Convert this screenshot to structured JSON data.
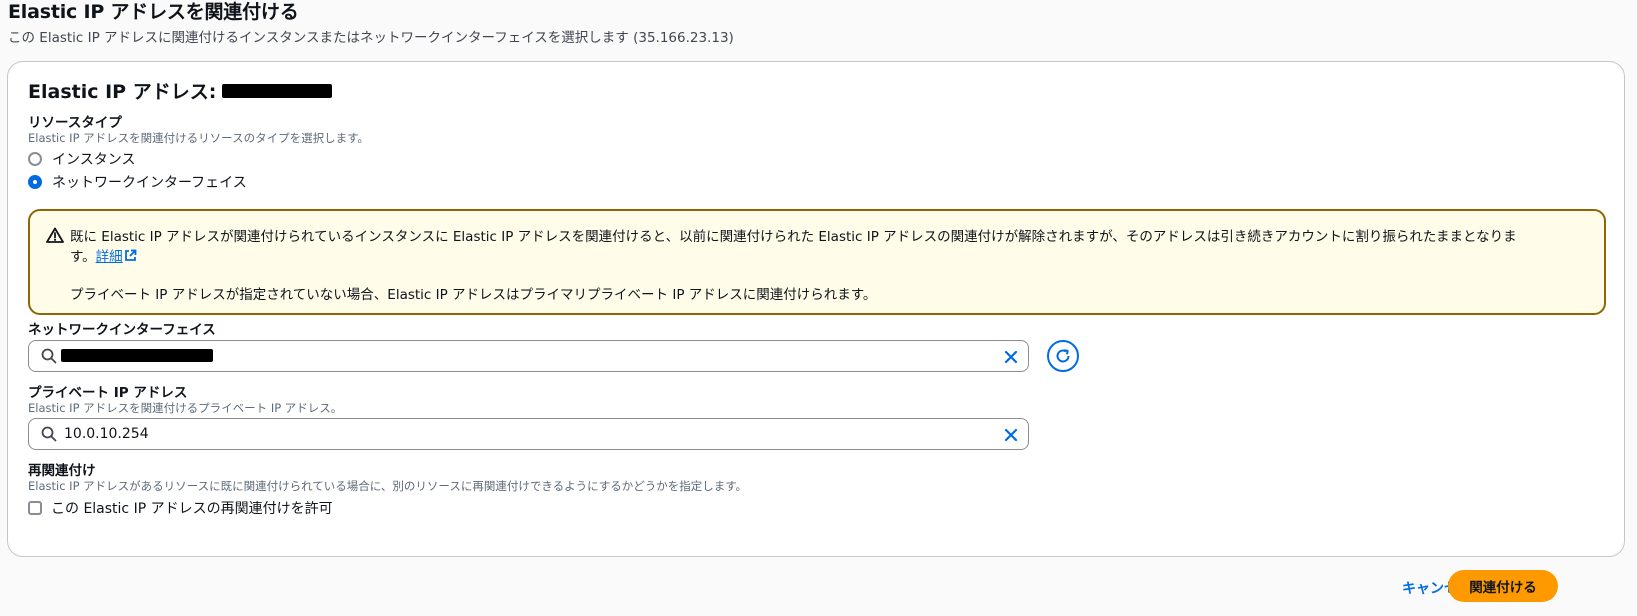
{
  "page": {
    "title": "Elastic IP アドレスを関連付ける",
    "subtitle": "この Elastic IP アドレスに関連付けるインスタンスまたはネットワークインターフェイスを選択します (35.166.23.13)"
  },
  "panel": {
    "heading": "Elastic IP アドレス:"
  },
  "resource_type": {
    "label": "リソースタイプ",
    "description": "Elastic IP アドレスを関連付けるリソースのタイプを選択します。",
    "options": [
      {
        "label": "インスタンス",
        "selected": false
      },
      {
        "label": "ネットワークインターフェイス",
        "selected": true
      }
    ]
  },
  "alert": {
    "line1": "既に Elastic IP アドレスが関連付けられているインスタンスに Elastic IP アドレスを関連付けると、以前に関連付けられた Elastic IP アドレスの関連付けが解除されますが、そのアドレスは引き続きアカウントに割り振られたままとなりま",
    "line2": "す。",
    "link": "詳細",
    "line3": "プライベート IP アドレスが指定されていない場合、Elastic IP アドレスはプライマリプライベート IP アドレスに関連付けられます。"
  },
  "network_interface": {
    "label": "ネットワークインターフェイス"
  },
  "private_ip": {
    "label": "プライベート IP アドレス",
    "description": "Elastic IP アドレスを関連付けるプライベート IP アドレス。",
    "value": "10.0.10.254"
  },
  "reassociation": {
    "label": "再関連付け",
    "description": "Elastic IP アドレスがあるリソースに既に関連付けられている場合に、別のリソースに再関連付けできるようにするかどうかを指定します。",
    "checkbox_label": "この Elastic IP アドレスの再関連付けを許可",
    "checked": false
  },
  "actions": {
    "cancel": "キャンセル",
    "associate": "関連付ける"
  },
  "colors": {
    "accent": "#006ce0",
    "primary": "#ff9900",
    "warning_border": "#8d6605",
    "warning_bg": "#fffce9"
  }
}
